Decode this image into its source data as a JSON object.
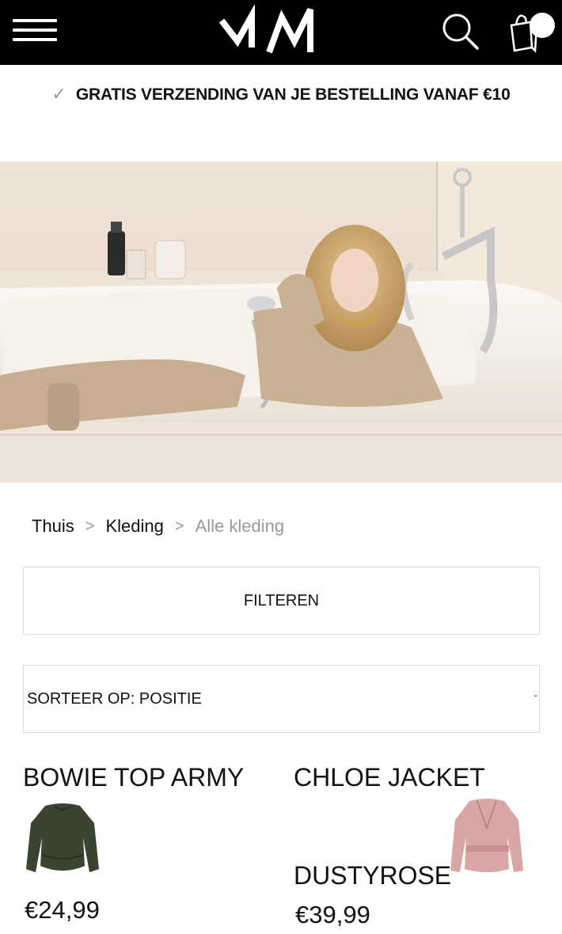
{
  "header": {
    "menu_icon": "hamburger-menu-icon",
    "logo_text": "MW",
    "search_icon": "search-icon",
    "cart_icon": "shopping-bag-icon"
  },
  "shipping_banner": {
    "icon": "checkmark-icon",
    "text": "GRATIS VERZENDING VAN JE BESTELLING VANAF €10"
  },
  "breadcrumb": {
    "items": [
      "Thuis",
      "Kleding",
      "Alle kleding"
    ],
    "separator": ">"
  },
  "filter_button": {
    "label": "FILTEREN"
  },
  "sort": {
    "label": "SORTEER OP: POSITIE",
    "chevron": "ˇ"
  },
  "products": [
    {
      "name": "BOWIE TOP ARMY",
      "price": "€24,99",
      "color": "#3b4331"
    },
    {
      "name_line1": "CHLOE JACKET",
      "name_line2": "DUSTYROSE",
      "price": "€39,99",
      "color": "#d8a6a4"
    }
  ],
  "colors": {
    "header_bg": "#000000",
    "accent_text": "#111111",
    "muted_text": "#999999"
  }
}
